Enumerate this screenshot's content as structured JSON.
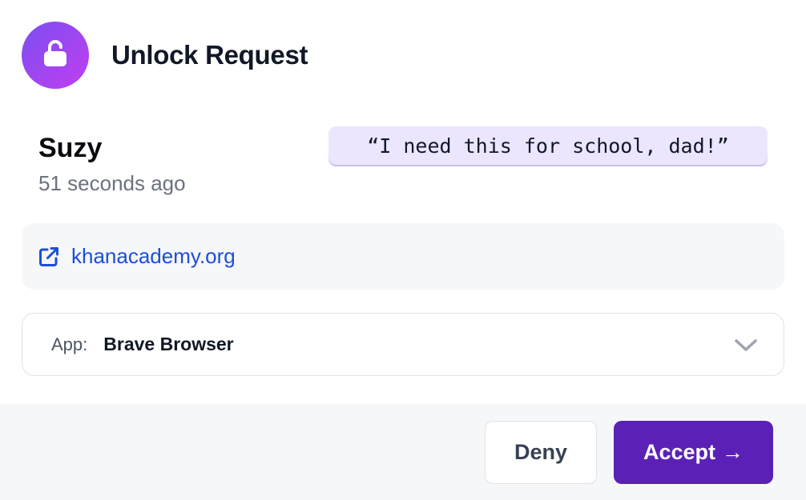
{
  "dialog": {
    "title": "Unlock Request",
    "lock_icon": "unlocked-padlock-icon"
  },
  "request": {
    "requester_name": "Suzy",
    "time_ago": "51 seconds ago",
    "message": "“I need this for school, dad!”"
  },
  "link": {
    "icon": "external-link-icon",
    "text": "khanacademy.org"
  },
  "app_select": {
    "label": "App:",
    "value": "Brave Browser",
    "icon": "chevron-down-icon"
  },
  "actions": {
    "deny_label": "Deny",
    "accept_label": "Accept",
    "accept_icon": "arrow-right-icon",
    "accept_arrow": "→"
  },
  "colors": {
    "accent": "#5b21b6",
    "badge_gradient_start": "#7b4ff0",
    "badge_gradient_end": "#c13ef0",
    "message_bg": "#ebe5fd",
    "link": "#1d4ed8"
  }
}
